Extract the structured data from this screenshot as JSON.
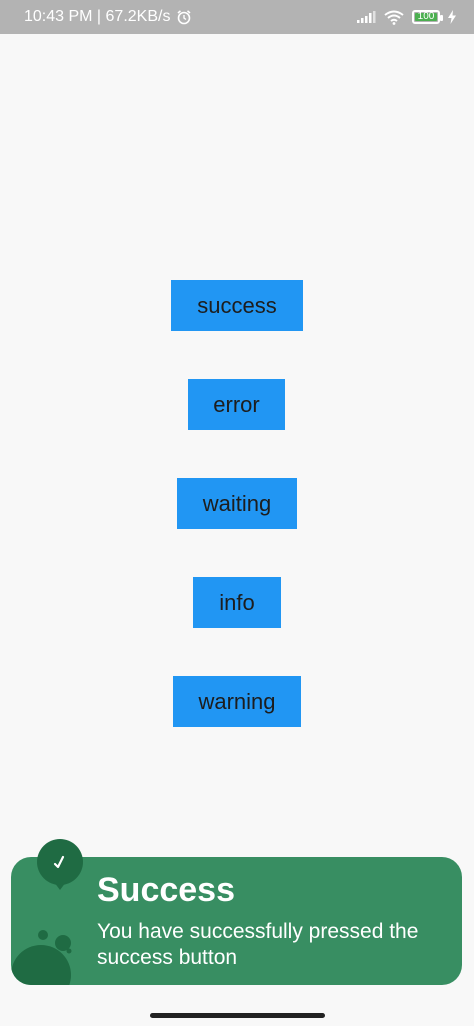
{
  "status_bar": {
    "left_text": "10:43 PM | 67.2KB/s",
    "battery_level": "100",
    "icons": [
      "alarm-icon",
      "signal-icon",
      "wifi-icon",
      "battery-icon",
      "charging-bolt-icon"
    ]
  },
  "buttons": {
    "success": "success",
    "error": "error",
    "waiting": "waiting",
    "info": "info",
    "warning": "warning"
  },
  "toast": {
    "title": "Success",
    "message": "You have successfully pressed the success button",
    "icon": "check-icon",
    "color": "#388e62"
  },
  "colors": {
    "button_bg": "#2196f3",
    "background": "#f8f8f8",
    "status_bar_bg": "#b3b3b3"
  }
}
